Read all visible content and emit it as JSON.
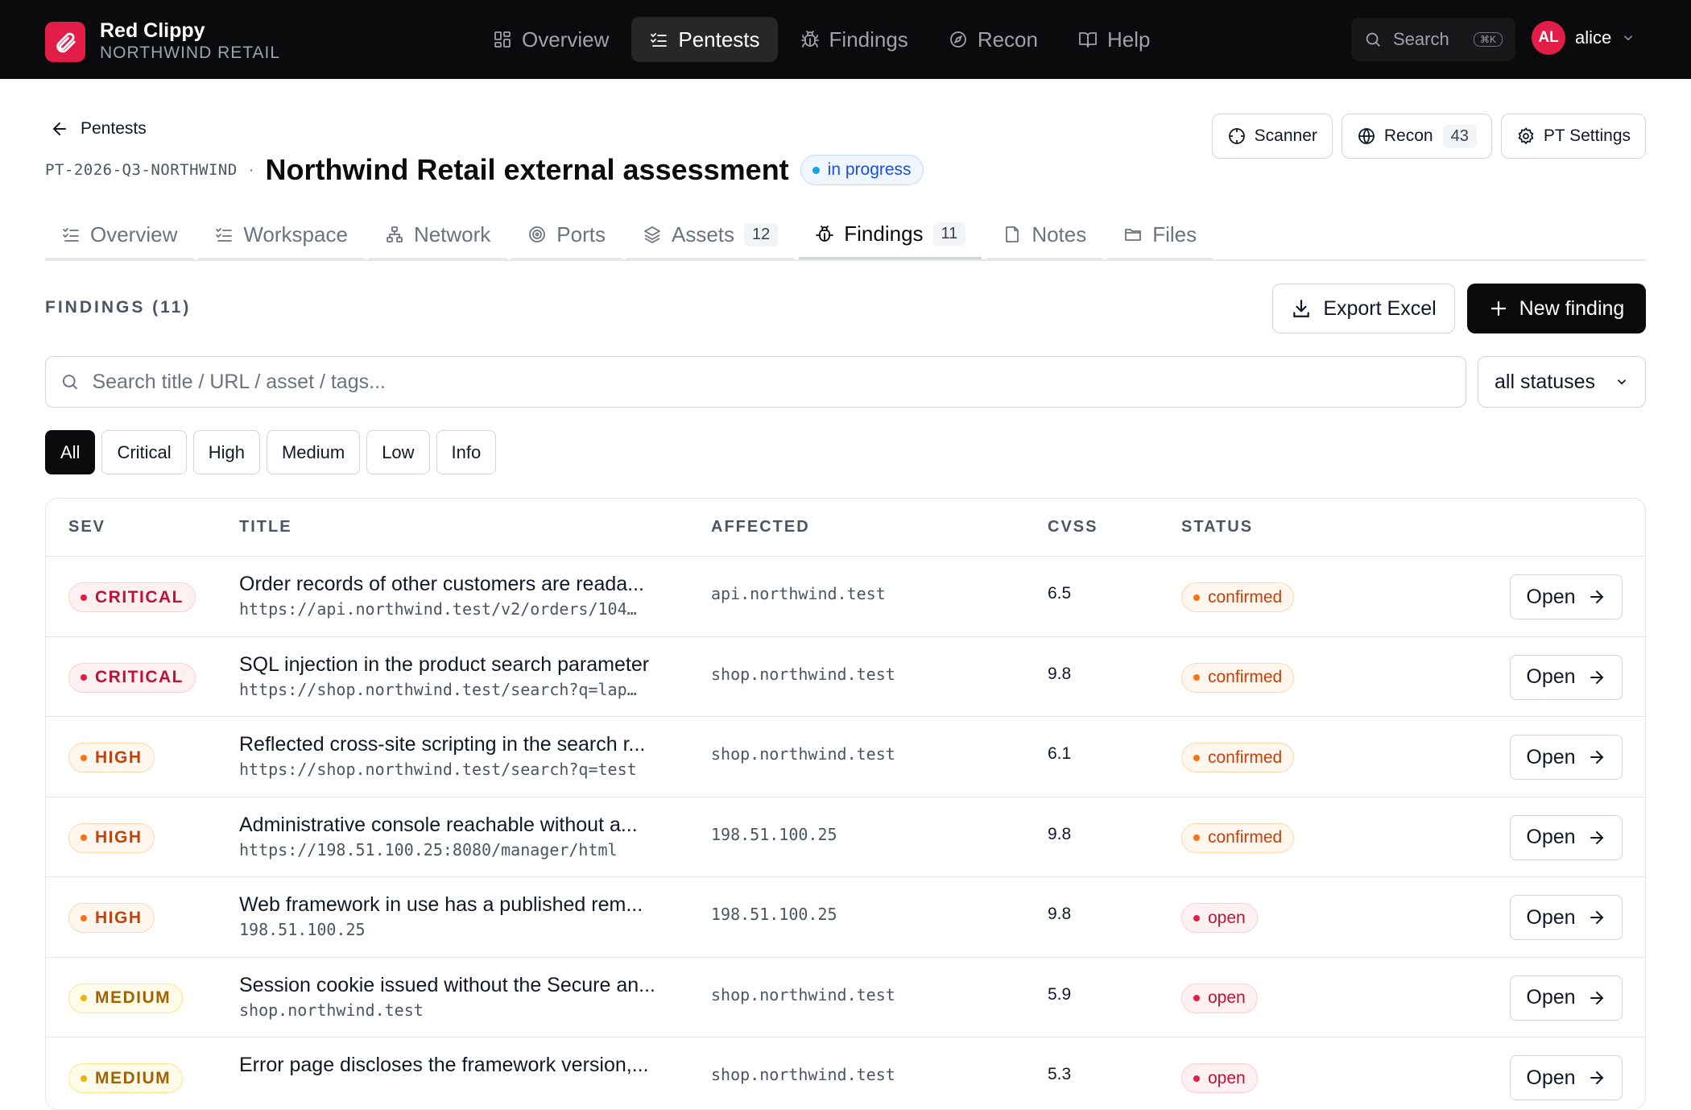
{
  "app": {
    "name": "Red Clippy",
    "org": "NORTHWIND RETAIL"
  },
  "nav": [
    {
      "label": "Overview",
      "icon": "grid-icon"
    },
    {
      "label": "Pentests",
      "icon": "list-check-icon",
      "active": true
    },
    {
      "label": "Findings",
      "icon": "bug-icon"
    },
    {
      "label": "Recon",
      "icon": "compass-icon"
    },
    {
      "label": "Help",
      "icon": "book-icon"
    }
  ],
  "top_search": {
    "label": "Search",
    "shortcut": "⌘K"
  },
  "user": {
    "initials": "AL",
    "name": "alice"
  },
  "header": {
    "back_label": "Pentests",
    "code": "PT-2026-Q3-NORTHWIND",
    "separator": "·",
    "title": "Northwind Retail external assessment",
    "status": "in progress",
    "actions": {
      "scanner": "Scanner",
      "recon": "Recon",
      "recon_count": "43",
      "settings": "PT Settings"
    }
  },
  "tabs": [
    {
      "label": "Overview",
      "icon": "list-check-icon"
    },
    {
      "label": "Workspace",
      "icon": "list-check-icon"
    },
    {
      "label": "Network",
      "icon": "network-icon"
    },
    {
      "label": "Ports",
      "icon": "target-icon"
    },
    {
      "label": "Assets",
      "icon": "layers-icon",
      "count": "12"
    },
    {
      "label": "Findings",
      "icon": "bug-icon",
      "count": "11",
      "active": true
    },
    {
      "label": "Notes",
      "icon": "note-icon"
    },
    {
      "label": "Files",
      "icon": "folder-icon"
    }
  ],
  "findings": {
    "section_title": "FINDINGS (11)",
    "export_label": "Export Excel",
    "new_label": "New finding",
    "search_placeholder": "Search title / URL / asset / tags...",
    "status_filter": "all statuses",
    "severity_filters": [
      "All",
      "Critical",
      "High",
      "Medium",
      "Low",
      "Info"
    ],
    "columns": {
      "sev": "SEV",
      "title": "TITLE",
      "affected": "AFFECTED",
      "cvss": "CVSS",
      "status": "STATUS"
    },
    "open_label": "Open",
    "rows": [
      {
        "sev": "CRITICAL",
        "sev_class": "critical",
        "title": "Order records of other customers are reada...",
        "url": "https://api.northwind.test/v2/orders/104…",
        "affected": "api.northwind.test",
        "cvss": "6.5",
        "status": "confirmed"
      },
      {
        "sev": "CRITICAL",
        "sev_class": "critical",
        "title": "SQL injection in the product search parameter",
        "url": "https://shop.northwind.test/search?q=lap…",
        "affected": "shop.northwind.test",
        "cvss": "9.8",
        "status": "confirmed"
      },
      {
        "sev": "HIGH",
        "sev_class": "high",
        "title": "Reflected cross-site scripting in the search r...",
        "url": "https://shop.northwind.test/search?q=test",
        "affected": "shop.northwind.test",
        "cvss": "6.1",
        "status": "confirmed"
      },
      {
        "sev": "HIGH",
        "sev_class": "high",
        "title": "Administrative console reachable without a...",
        "url": "https://198.51.100.25:8080/manager/html",
        "affected": "198.51.100.25",
        "cvss": "9.8",
        "status": "confirmed"
      },
      {
        "sev": "HIGH",
        "sev_class": "high",
        "title": "Web framework in use has a published rem...",
        "url": "198.51.100.25",
        "affected": "198.51.100.25",
        "cvss": "9.8",
        "status": "open"
      },
      {
        "sev": "MEDIUM",
        "sev_class": "medium",
        "title": "Session cookie issued without the Secure an...",
        "url": "shop.northwind.test",
        "affected": "shop.northwind.test",
        "cvss": "5.9",
        "status": "open"
      },
      {
        "sev": "MEDIUM",
        "sev_class": "medium",
        "title": "Error page discloses the framework version,...",
        "url": "",
        "affected": "shop.northwind.test",
        "cvss": "5.3",
        "status": "open"
      }
    ]
  }
}
